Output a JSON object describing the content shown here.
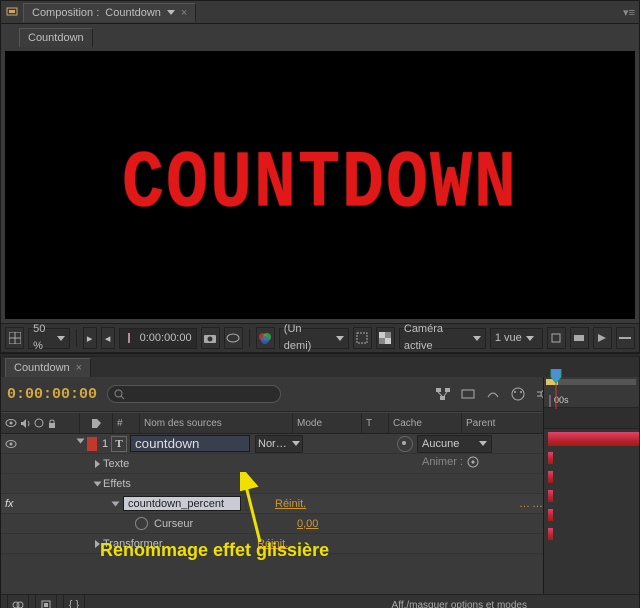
{
  "comp_panel": {
    "title_prefix": "Composition :",
    "title_name": "Countdown",
    "breadcrumb": "Countdown",
    "canvas_text": "COUNTDOWN"
  },
  "viewer_toolbar": {
    "zoom": "50 %",
    "timecode": "0:00:00:00",
    "resolution": "(Un demi)",
    "view3d": "Caméra active",
    "view_count": "1 vue"
  },
  "timeline": {
    "tab": "Countdown",
    "timecode": "0:00:00:00",
    "ruler_mark": "00s",
    "columns": {
      "num_sign": "#",
      "name": "Nom des sources",
      "mode": "Mode",
      "t": "T",
      "cache": "Cache",
      "parent": "Parent"
    },
    "layer": {
      "index": "1",
      "name": "countdown",
      "mode": "Nor…",
      "parent_pick": "Aucune",
      "animer": "Animer :",
      "groups": {
        "text": "Texte",
        "effects": "Effets",
        "transform": "Transformer"
      },
      "effect": {
        "name": "countdown_percent",
        "reset": "Réinit.",
        "cursor_label": "Curseur",
        "cursor_value": "0,00"
      },
      "transform_reset": "Réinit."
    }
  },
  "footer": {
    "right_text": "Aff./masquer options et modes"
  },
  "annotation": "Renommage effet glissière"
}
